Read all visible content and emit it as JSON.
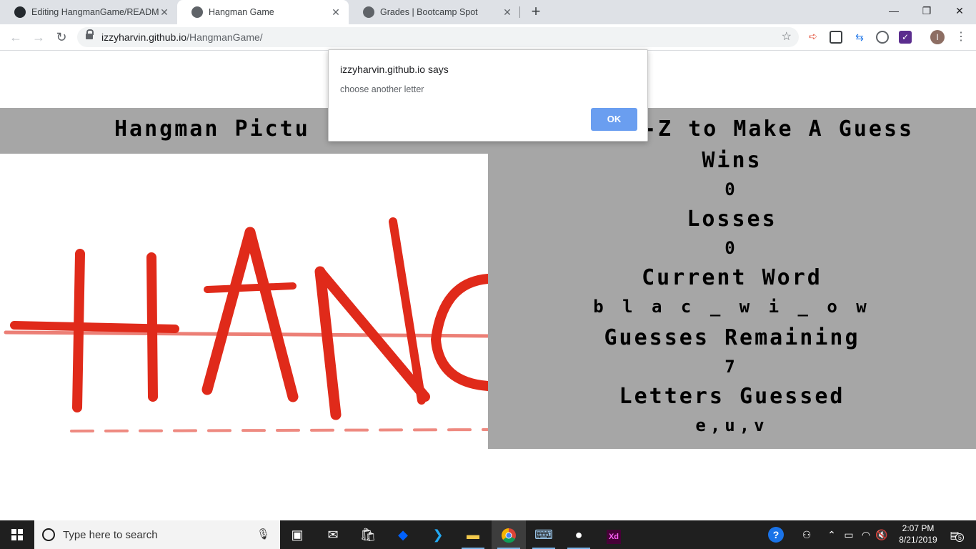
{
  "browser": {
    "tabs": [
      {
        "title": "Editing HangmanGame/README",
        "active": false
      },
      {
        "title": "Hangman Game",
        "active": true
      },
      {
        "title": "Grades | Bootcamp Spot",
        "active": false
      }
    ],
    "new_tab": "+",
    "window_controls": {
      "minimize": "—",
      "maximize": "❐",
      "close": "✕"
    },
    "nav": {
      "back": "←",
      "forward": "→",
      "reload": "↻"
    },
    "url_domain": "izzyharvin.github.io",
    "url_path": "/HangmanGame/",
    "star": "☆",
    "profile_initial": "I"
  },
  "game": {
    "header_left": "Hangman Pictu",
    "header_right": "-Z to Make A Guess",
    "image_text": "HANG",
    "wins_label": "Wins",
    "wins_value": "0",
    "losses_label": "Losses",
    "losses_value": "0",
    "current_word_label": "Current Word",
    "current_word_value": "b l a c _   w i _ o w",
    "guesses_remaining_label": "Guesses Remaining",
    "guesses_remaining_value": "7",
    "letters_guessed_label": "Letters Guessed",
    "letters_guessed_value": "e,u,v"
  },
  "dialog": {
    "title": "izzyharvin.github.io says",
    "message": "choose another letter",
    "ok_label": "OK"
  },
  "taskbar": {
    "search_placeholder": "Type here to search",
    "time": "2:07 PM",
    "date": "8/21/2019",
    "notifications_count": "5"
  },
  "colors": {
    "panel_gray": "#a6a6a6",
    "brush_red": "#e02a1a",
    "ok_blue": "#6a9ef0",
    "taskbar": "#1f1f1f"
  }
}
